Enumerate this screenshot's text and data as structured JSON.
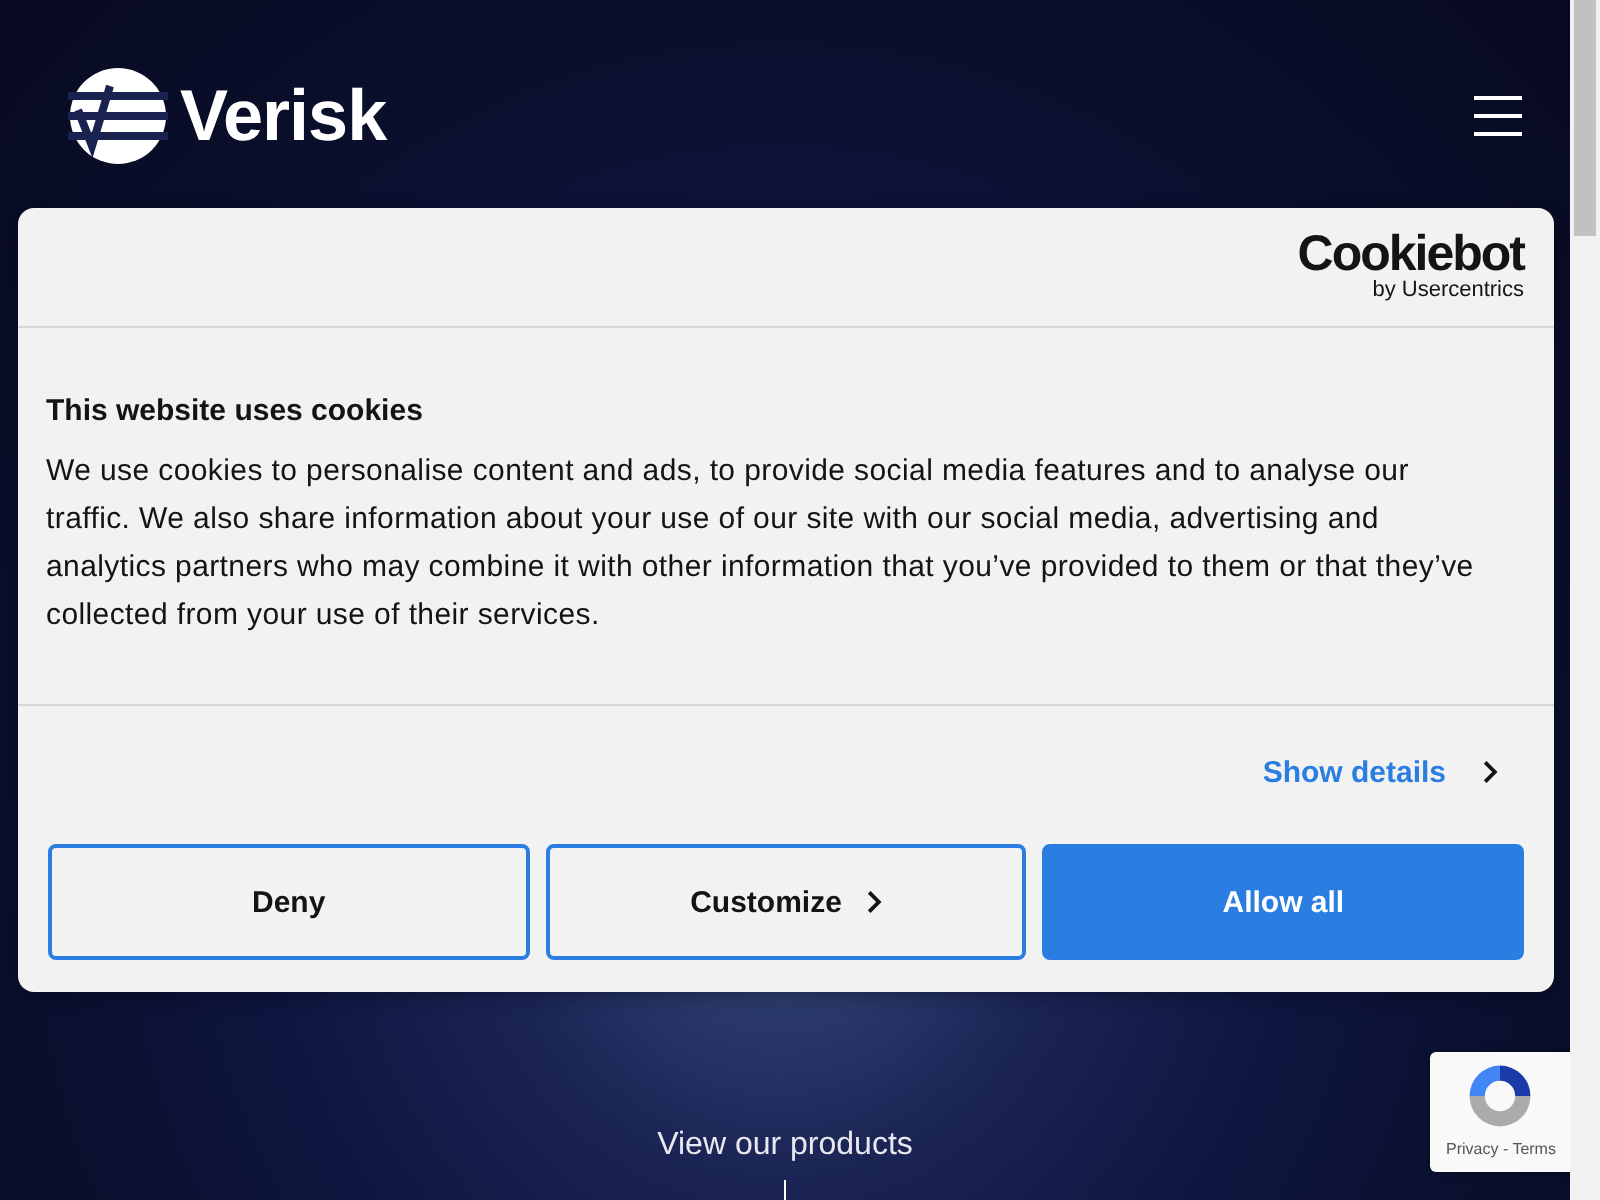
{
  "header": {
    "logo_text": "Verisk"
  },
  "cookie_dialog": {
    "brand": {
      "name": "Cookiebot",
      "byline": "by Usercentrics"
    },
    "title": "This website uses cookies",
    "body": "We use cookies to personalise content and ads, to provide social media features and to analyse our traffic. We also share information about your use of our site with our social media, advertising and analytics partners who may combine it with other information that you’ve provided to them or that they’ve collected from your use of their services.",
    "show_details": "Show details",
    "buttons": [
      {
        "label": "Deny",
        "kind": "outline",
        "chevron": false
      },
      {
        "label": "Customize",
        "kind": "outline",
        "chevron": true
      },
      {
        "label": "Allow all",
        "kind": "primary",
        "chevron": false
      }
    ]
  },
  "hero": {
    "link": "View our products"
  },
  "recaptcha": {
    "links": "Privacy - Terms"
  }
}
